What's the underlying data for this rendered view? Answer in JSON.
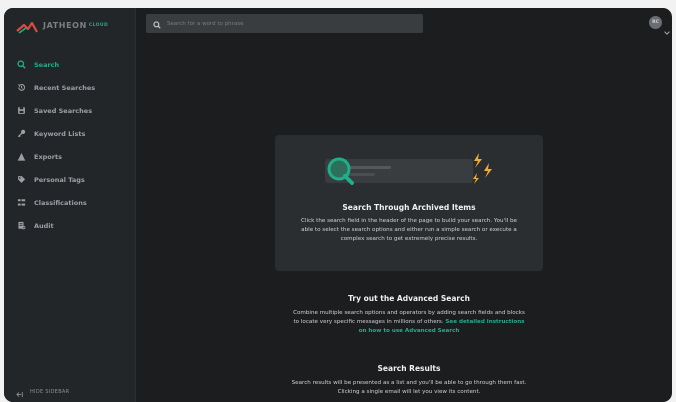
{
  "brand": {
    "name": "JATHEON",
    "sub": "CLOUD",
    "accent": "#1eaf8c",
    "mark_color": "#d94c3f"
  },
  "header": {
    "search_placeholder": "Search for a word to phrase",
    "avatar_initials": "RC"
  },
  "sidebar": {
    "items": [
      {
        "label": "Search",
        "icon": "search-icon",
        "active": true
      },
      {
        "label": "Recent Searches",
        "icon": "history-icon",
        "active": false
      },
      {
        "label": "Saved Searches",
        "icon": "save-icon",
        "active": false
      },
      {
        "label": "Keyword Lists",
        "icon": "key-icon",
        "active": false
      },
      {
        "label": "Exports",
        "icon": "export-icon",
        "active": false
      },
      {
        "label": "Personal Tags",
        "icon": "tag-icon",
        "active": false
      },
      {
        "label": "Classifications",
        "icon": "classification-icon",
        "active": false
      },
      {
        "label": "Audit",
        "icon": "audit-icon",
        "active": false
      }
    ],
    "hide_label": "HIDE SIDEBAR"
  },
  "hero": {
    "title": "Search Through Archived Items",
    "text": "Click the search field in the header of the page to build your search. You'll be able to select the search options and either run a simple search or execute a complex search to get extremely precise results."
  },
  "advanced": {
    "title": "Try out the Advanced Search",
    "text": "Combine multiple search options and operators by adding search fields and blocks to locate very specific messages in millions of others.",
    "link": "See detailed instructions on how to use Advanced Search"
  },
  "results": {
    "title": "Search Results",
    "text": "Search results will be presented as a list and you'll be able to go through them fast. Clicking a single email will let you view its content."
  }
}
